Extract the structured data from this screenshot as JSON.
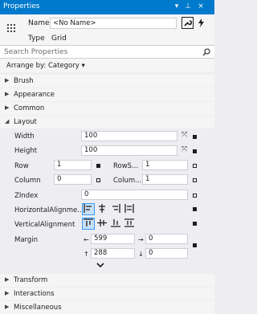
{
  "title_bar": {
    "title": "Properties",
    "pin_glyph": "▾",
    "autohide_glyph": "⊥",
    "close_glyph": "×"
  },
  "header": {
    "icon": "grid-icon",
    "name_label": "Name",
    "name_value": "<No Name>",
    "type_label": "Type",
    "type_value": "Grid",
    "properties_button_icon": "wrench-icon",
    "events_button_icon": "lightning-icon"
  },
  "search": {
    "placeholder": "Search Properties",
    "icon": "search-icon"
  },
  "arrange": {
    "label": "Arrange by: Category ▾"
  },
  "categories_top": [
    {
      "label": "Brush",
      "expanded": false
    },
    {
      "label": "Appearance",
      "expanded": false
    },
    {
      "label": "Common",
      "expanded": false
    },
    {
      "label": "Layout",
      "expanded": true
    }
  ],
  "layout": {
    "width_label": "Width",
    "width_value": "100",
    "height_label": "Height",
    "height_value": "100",
    "row_label": "Row",
    "row_value": "1",
    "rowspan_label": "RowS...",
    "rowspan_value": "1",
    "column_label": "Column",
    "column_value": "0",
    "columnspan_label": "Colum...",
    "columnspan_value": "1",
    "zindex_label": "ZIndex",
    "zindex_value": "0",
    "halign_label": "HorizontalAlignme...",
    "valign_label": "VerticalAlignment",
    "margin_label": "Margin",
    "margin_left": "599",
    "margin_right": "0",
    "margin_top": "288",
    "margin_bottom": "0",
    "horizontal_selected": "left",
    "vertical_selected": "top"
  },
  "categories_bottom": [
    {
      "label": "Transform",
      "expanded": false
    },
    {
      "label": "Interactions",
      "expanded": false
    },
    {
      "label": "Miscellaneous",
      "expanded": false
    }
  ],
  "glyphs": {
    "collapsed": "▶",
    "expanded": "◢",
    "star_icon": "⤧",
    "more_chevron": "⌄",
    "arrow_left": "←",
    "arrow_right": "→",
    "arrow_up": "↑",
    "arrow_down": "↓"
  },
  "colors": {
    "accent": "#007acc",
    "panel": "#f5f5f5",
    "selected_button": "#c9e0f7"
  }
}
